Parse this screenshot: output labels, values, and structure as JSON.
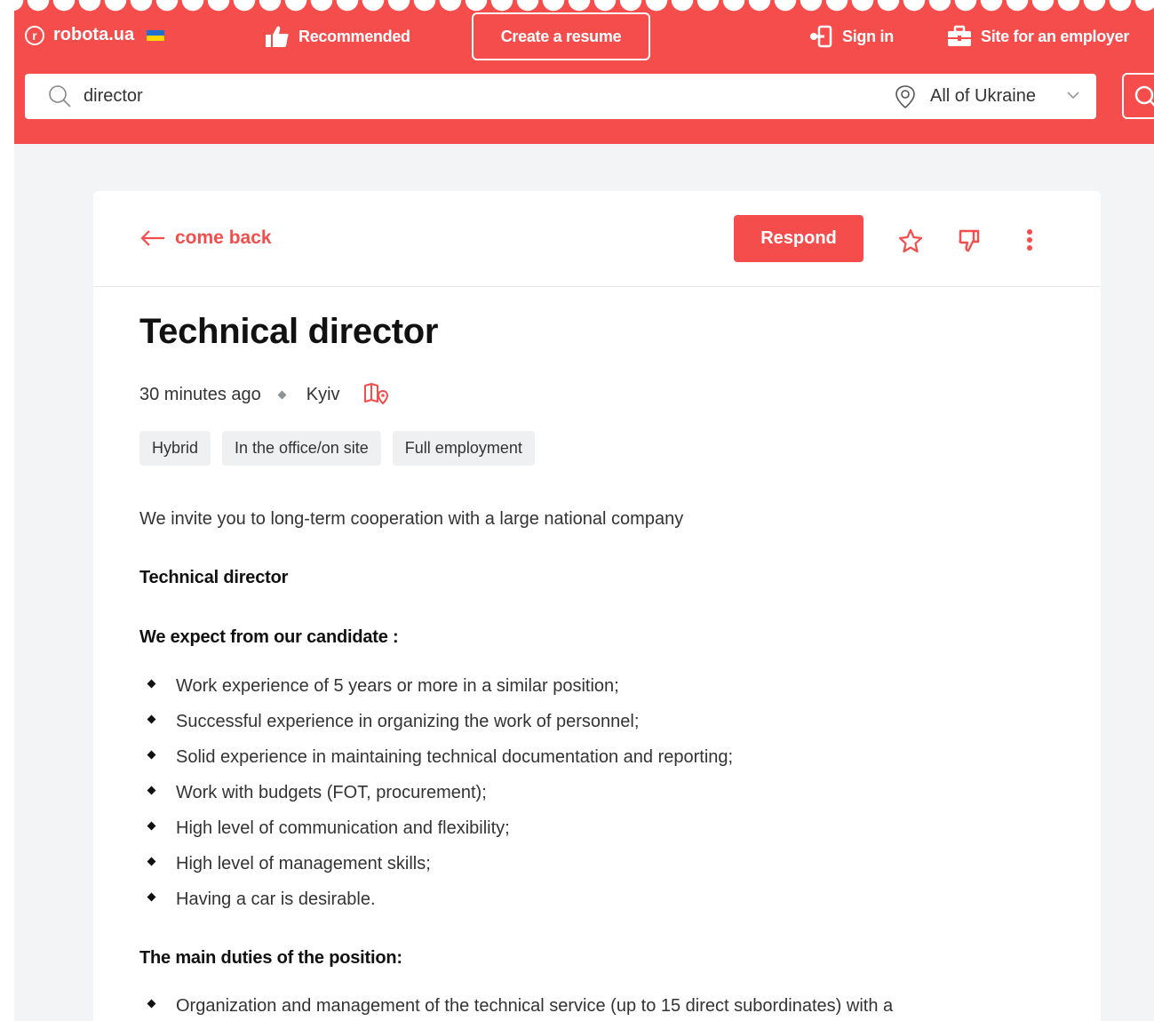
{
  "header": {
    "logo_text": "robota.ua",
    "logo_letter": "r",
    "recommended_label": "Recommended",
    "create_resume_label": "Create a resume",
    "sign_in_label": "Sign in",
    "employer_label": "Site for an employer",
    "accent_color": "#f54c4c"
  },
  "search": {
    "query": "director",
    "location": "All of Ukraine"
  },
  "toolbar": {
    "back_label": "come back",
    "respond_label": "Respond"
  },
  "job": {
    "title": "Technical director",
    "posted": "30 minutes ago",
    "city": "Kyiv",
    "tags": [
      "Hybrid",
      "In the office/on site",
      "Full employment"
    ],
    "intro": "We invite you to long-term cooperation with a large national company",
    "subtitle": "Technical director",
    "expect_heading": "We expect from our candidate :",
    "expectations": [
      "Work experience of 5 years or more in a similar position;",
      "Successful experience in organizing the work of personnel;",
      "Solid experience in maintaining technical documentation and reporting;",
      "Work with budgets (FOT, procurement);",
      "High level of communication and flexibility;",
      "High level of management skills;",
      "Having a car is desirable."
    ],
    "duties_heading": "The main duties of the position:",
    "duties": [
      "Organization and management of the technical service (up to 15 direct subordinates) with a"
    ]
  }
}
